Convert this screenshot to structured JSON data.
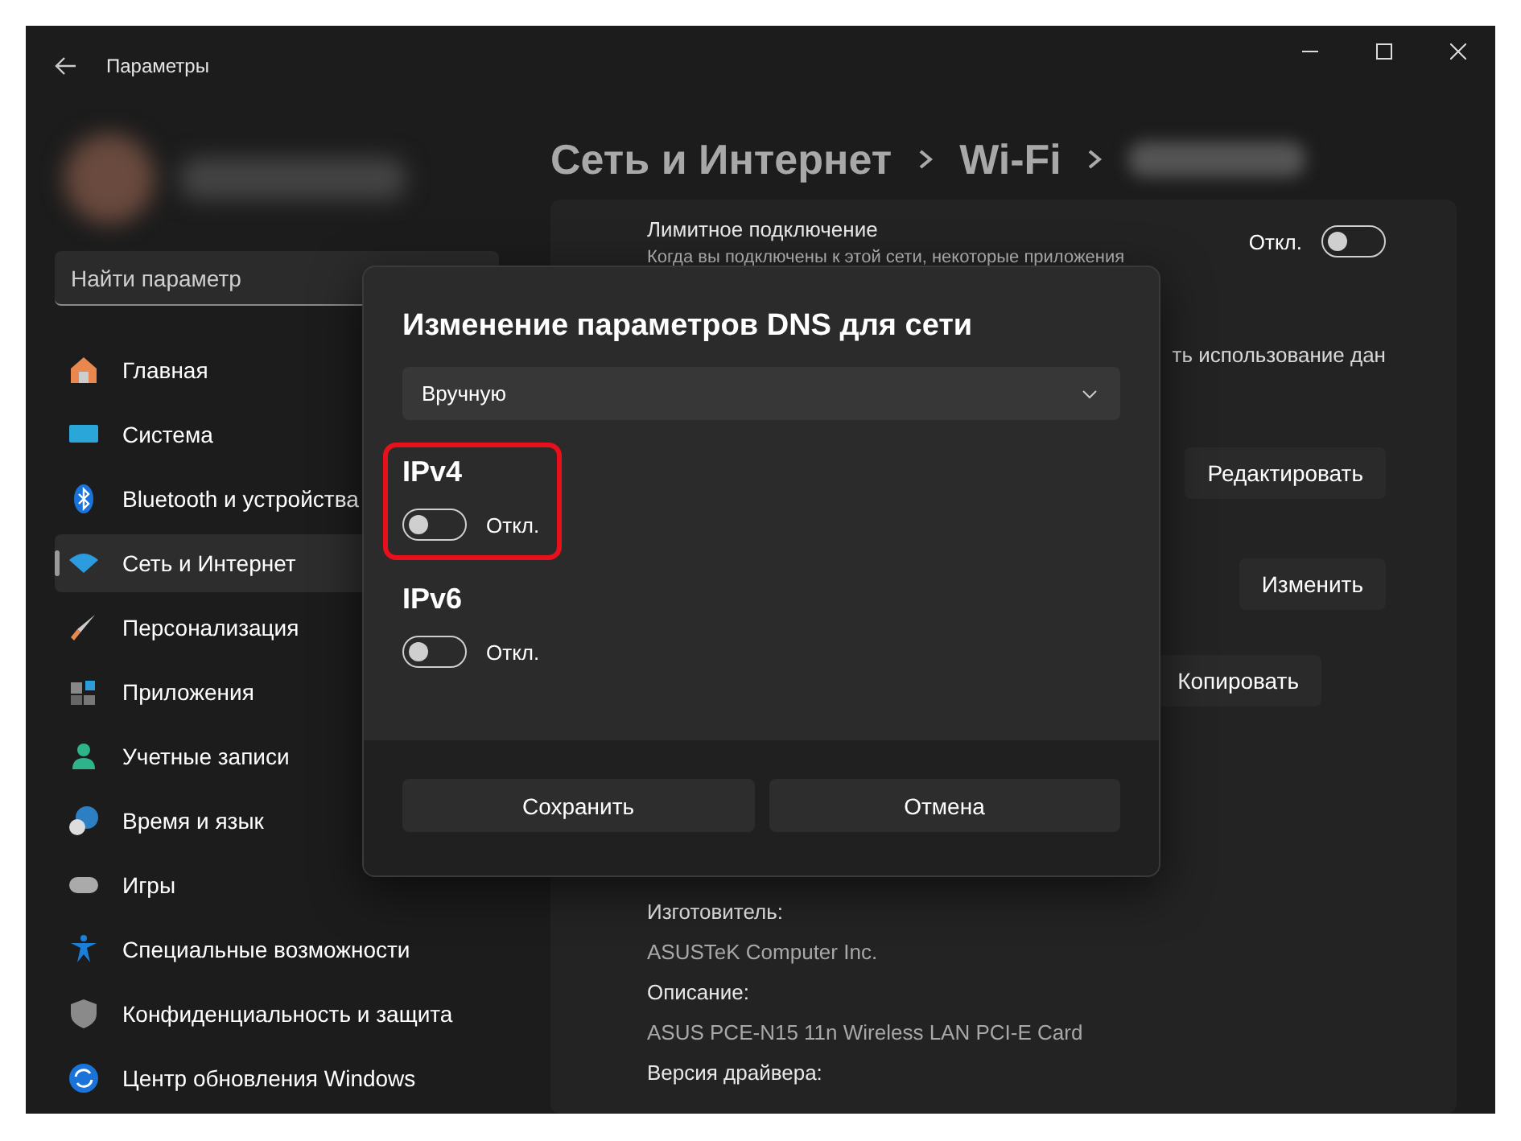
{
  "window": {
    "title": "Параметры"
  },
  "sidebar": {
    "search": {
      "placeholder": "Найти параметр"
    },
    "items": [
      {
        "label": "Главная",
        "selected": false
      },
      {
        "label": "Система",
        "selected": false
      },
      {
        "label": "Bluetooth и устройства",
        "selected": false
      },
      {
        "label": "Сеть и Интернет",
        "selected": true
      },
      {
        "label": "Персонализация",
        "selected": false
      },
      {
        "label": "Приложения",
        "selected": false
      },
      {
        "label": "Учетные записи",
        "selected": false
      },
      {
        "label": "Время и язык",
        "selected": false
      },
      {
        "label": "Игры",
        "selected": false
      },
      {
        "label": "Специальные возможности",
        "selected": false
      },
      {
        "label": "Конфиденциальность и защита",
        "selected": false
      },
      {
        "label": "Центр обновления Windows",
        "selected": false
      }
    ]
  },
  "breadcrumb": [
    "Сеть и Интернет",
    "Wi-Fi"
  ],
  "content": {
    "metered": {
      "title": "Лимитное подключение",
      "description": "Когда вы подключены к этой сети, некоторые приложения",
      "state_label": "Откл.",
      "on": false
    },
    "partial_text": "ть использование дан",
    "buttons": [
      "Редактировать",
      "Изменить",
      "Копировать"
    ],
    "properties": [
      {
        "kind": "label",
        "text": "Изготовитель:"
      },
      {
        "kind": "value",
        "text": "ASUSTeK Computer Inc."
      },
      {
        "kind": "label",
        "text": "Описание:"
      },
      {
        "kind": "value",
        "text": "ASUS PCE-N15 11n Wireless LAN PCI-E Card"
      },
      {
        "kind": "label",
        "text": "Версия драйвера:"
      }
    ]
  },
  "dialog": {
    "title": "Изменение параметров DNS для сети",
    "mode": "Вручную",
    "sections": [
      {
        "title": "IPv4",
        "state_label": "Откл.",
        "on": false,
        "highlighted": true
      },
      {
        "title": "IPv6",
        "state_label": "Откл.",
        "on": false,
        "highlighted": false
      }
    ],
    "buttons": [
      "Сохранить",
      "Отмена"
    ]
  }
}
